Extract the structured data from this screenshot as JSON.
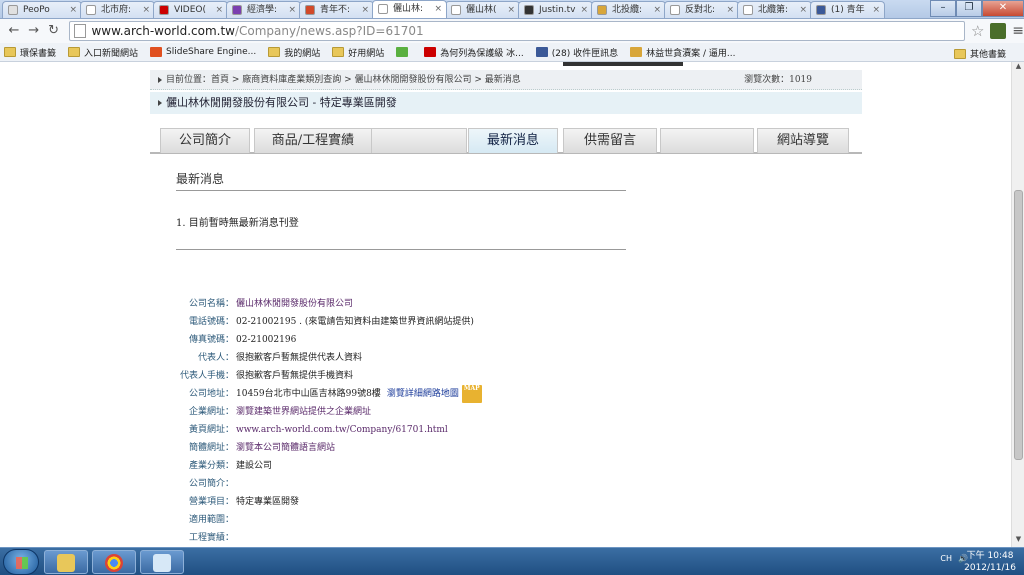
{
  "browser": {
    "tabs": [
      {
        "label": "PeoPo",
        "favicon": "#e0e0e0"
      },
      {
        "label": "北市府:",
        "favicon": "#ffffff"
      },
      {
        "label": "VIDEO(",
        "favicon": "#cc0000"
      },
      {
        "label": "經濟學:",
        "favicon": "#7b3fb0"
      },
      {
        "label": "青年不:",
        "favicon": "#d24a2a"
      },
      {
        "label": "儷山林:",
        "favicon": "#ffffff"
      },
      {
        "label": "儷山林(",
        "favicon": "#ffffff"
      },
      {
        "label": "Justin.tv",
        "favicon": "#333333"
      },
      {
        "label": "北投纜:",
        "favicon": "#d8a63a"
      },
      {
        "label": "反對北:",
        "favicon": "#ffffff"
      },
      {
        "label": "北纜第:",
        "favicon": "#ffffff"
      },
      {
        "label": "(1) 青年",
        "favicon": "#3b5998"
      }
    ],
    "active_tab_index": 5,
    "url_host": "www.arch-world.com.tw",
    "url_path": "/Company/news.asp?ID=61701",
    "bookmarks": [
      {
        "label": "環保書籤",
        "icon": "folder"
      },
      {
        "label": "入口新聞網站",
        "icon": "folder"
      },
      {
        "label": "SlideShare Engine...",
        "icon": "slideshare"
      },
      {
        "label": "我的網站",
        "icon": "folder"
      },
      {
        "label": "好用網站",
        "icon": "folder"
      },
      {
        "label": "",
        "icon": "green-circle"
      },
      {
        "label": "為何列為保護級 冰...",
        "icon": "youtube"
      },
      {
        "label": "(28) 收件匣訊息",
        "icon": "facebook"
      },
      {
        "label": "林益世貪瀆案 / 逼用...",
        "icon": "folder-yellow"
      }
    ],
    "other_bookmarks": "其他書籤"
  },
  "page": {
    "breadcrumb": "目前位置：首頁 > 廠商資料庫產業類別查詢 > 儷山林休閒開發股份有限公司 > 最新消息",
    "view_counter": "瀏覽次數：1019",
    "company_header": "儷山林休閒開發股份有限公司 - 特定專業區開發",
    "nav_tabs": [
      "公司簡介",
      "商品/工程實績",
      "",
      "最新消息",
      "供需留言",
      "",
      "網站導覽"
    ],
    "active_nav_index": 3,
    "section_title": "最新消息",
    "news_item": "1. 目前暫時無最新消息刊登",
    "info_rows": [
      {
        "label": "公司名稱：",
        "value": "儷山林休閒開發股份有限公司",
        "style": "link"
      },
      {
        "label": "電話號碼：",
        "value": "02-21002195 . (來電請告知資料由建築世界資訊網站提供)",
        "style": "plain"
      },
      {
        "label": "傳真號碼：",
        "value": "02-21002196",
        "style": "plain"
      },
      {
        "label": "代表人：",
        "value": "很抱歉客戶暫無提供代表人資料",
        "style": "plain"
      },
      {
        "label": "代表人手機：",
        "value": "很抱歉客戶暫無提供手機資料",
        "style": "plain"
      },
      {
        "label": "公司地址：",
        "value": "10459台北市中山區吉林路99號8樓",
        "extra": "瀏覽詳細網路地圖",
        "badge": "MAP",
        "style": "plain"
      },
      {
        "label": "企業網址：",
        "value": "瀏覽建築世界網站提供之企業網址",
        "style": "link"
      },
      {
        "label": "黃頁網址：",
        "value": "www.arch-world.com.tw/Company/61701.html",
        "style": "link"
      },
      {
        "label": "簡體網址：",
        "value": "瀏覽本公司簡體語言網站",
        "style": "link"
      },
      {
        "label": "產業分類：",
        "value": "建設公司",
        "style": "plain"
      },
      {
        "label": "公司簡介：",
        "value": "",
        "style": "plain"
      },
      {
        "label": "營業項目：",
        "value": "特定專業區開發",
        "style": "plain"
      },
      {
        "label": "適用範圍：",
        "value": "",
        "style": "plain"
      },
      {
        "label": "工程實績：",
        "value": "",
        "style": "plain"
      }
    ]
  },
  "taskbar": {
    "time": "下午 10:48",
    "date": "2012/11/16",
    "lang": "CH"
  }
}
